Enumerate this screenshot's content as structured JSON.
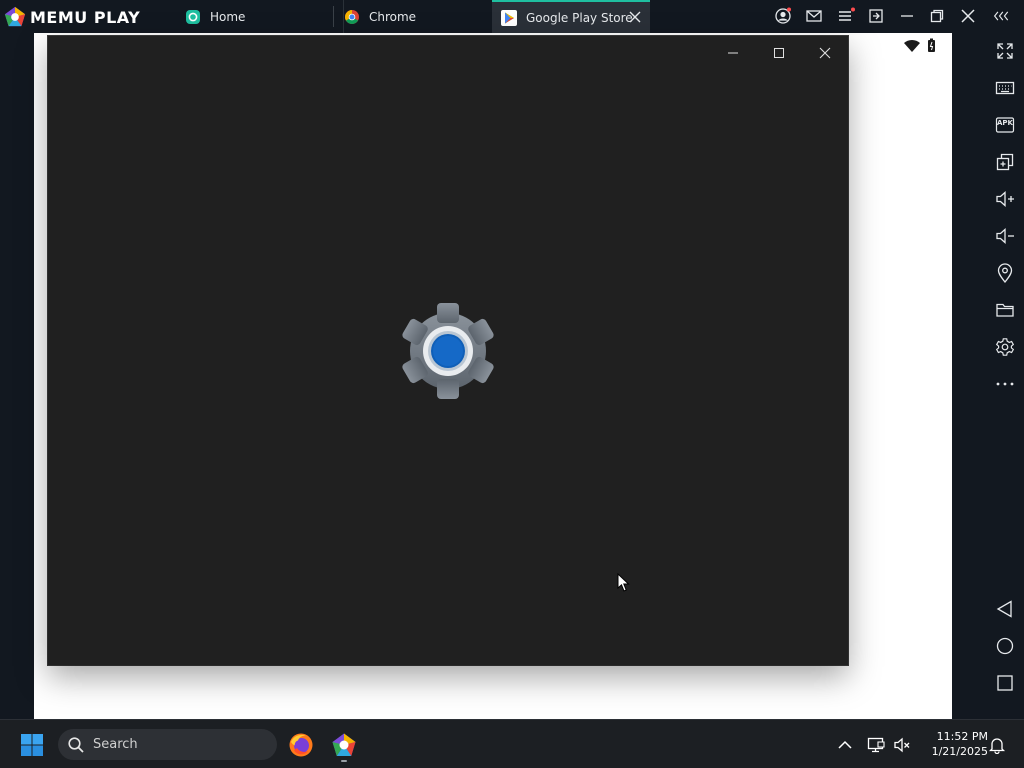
{
  "emulator": {
    "brand": "MEMU PLAY",
    "tabs": [
      {
        "label": "Home",
        "icon": "home-app-icon",
        "active": false
      },
      {
        "label": "Chrome",
        "icon": "chrome-icon",
        "active": false
      },
      {
        "label": "Google Play Store",
        "icon": "play-store-icon",
        "active": true
      }
    ],
    "title_icons": [
      "account-icon",
      "mail-icon",
      "menu-icon",
      "multi-window-icon",
      "minimize-icon",
      "restore-icon",
      "close-icon",
      "collapse-icon"
    ],
    "sidebar_icons": [
      "fullscreen-icon",
      "keyboard-icon",
      "apk-icon",
      "add-window-icon",
      "volume-up-icon",
      "volume-down-icon",
      "location-icon",
      "folder-icon",
      "settings-icon",
      "more-icon",
      "back-icon",
      "home-icon",
      "recents-icon"
    ],
    "apk_label": "APK"
  },
  "android_status": {
    "icons": [
      "wifi-icon",
      "battery-icon"
    ]
  },
  "settings_window": {
    "icon": "settings-gear-icon",
    "controls": [
      "minimize-icon",
      "maximize-icon",
      "close-icon"
    ]
  },
  "taskbar": {
    "search_placeholder": "Search",
    "apps": [
      "firefox-icon",
      "memu-icon"
    ],
    "time": "11:52 PM",
    "date": "1/21/2025",
    "tray_icons": [
      "chevron-up-icon",
      "display-icon",
      "volume-muted-icon",
      "notification-icon"
    ]
  },
  "colors": {
    "accent": "#1fbfa0",
    "window_bg": "#202020",
    "gear_blue": "#0f5fb8",
    "gear_gray": "#6e7680"
  }
}
